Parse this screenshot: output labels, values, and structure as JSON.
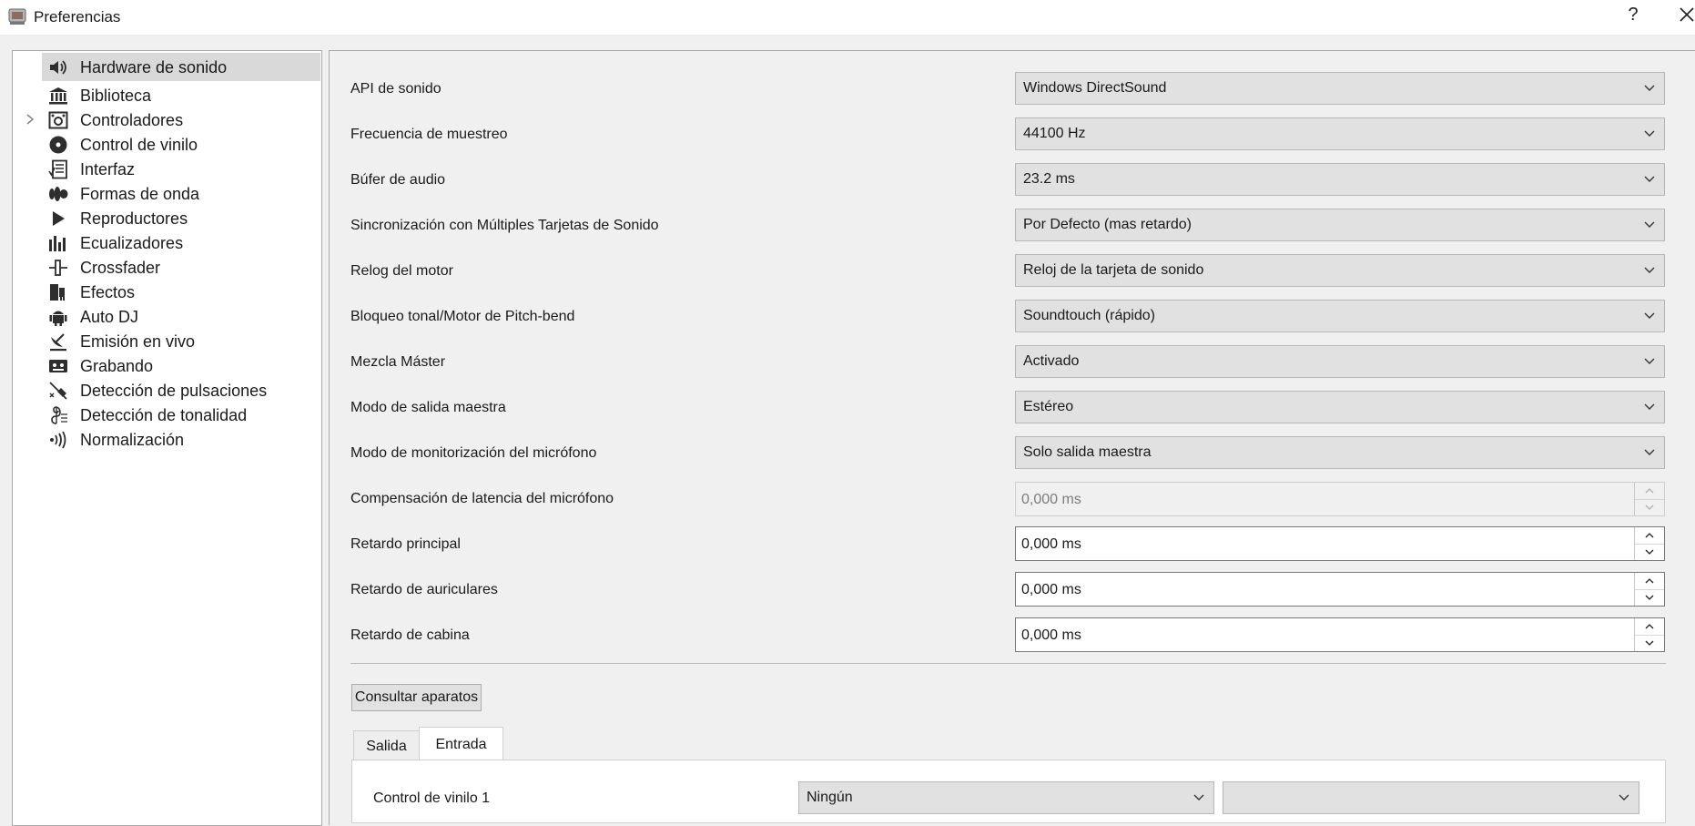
{
  "window": {
    "title": "Preferencias",
    "help": "?"
  },
  "sidebar": {
    "items": [
      {
        "label": "Hardware de sonido",
        "icon": "speaker-icon",
        "selected": true
      },
      {
        "label": "Biblioteca",
        "icon": "library-icon"
      },
      {
        "label": "Controladores",
        "icon": "controller-icon",
        "expandable": true
      },
      {
        "label": "Control de vinilo",
        "icon": "vinyl-icon"
      },
      {
        "label": "Interfaz",
        "icon": "interface-icon"
      },
      {
        "label": "Formas de onda",
        "icon": "waveform-icon"
      },
      {
        "label": "Reproductores",
        "icon": "play-icon"
      },
      {
        "label": "Ecualizadores",
        "icon": "equalizer-icon"
      },
      {
        "label": "Crossfader",
        "icon": "crossfader-icon"
      },
      {
        "label": "Efectos",
        "icon": "effects-icon"
      },
      {
        "label": "Auto DJ",
        "icon": "robot-icon"
      },
      {
        "label": "Emisión en vivo",
        "icon": "broadcast-icon"
      },
      {
        "label": "Grabando",
        "icon": "cassette-icon"
      },
      {
        "label": "Detección de pulsaciones",
        "icon": "metronome-icon"
      },
      {
        "label": "Detección de tonalidad",
        "icon": "music-key-icon"
      },
      {
        "label": "Normalización",
        "icon": "normalize-icon"
      }
    ]
  },
  "settings": [
    {
      "label": "API de sonido",
      "value": "Windows DirectSound",
      "kind": "combo"
    },
    {
      "label": "Frecuencia de muestreo",
      "value": "44100 Hz",
      "kind": "combo"
    },
    {
      "label": "Búfer de audio",
      "value": "23.2 ms",
      "kind": "combo"
    },
    {
      "label": "Sincronización con Múltiples Tarjetas de Sonido",
      "value": "Por Defecto (mas retardo)",
      "kind": "combo"
    },
    {
      "label": "Relog del motor",
      "value": "Reloj de la tarjeta de sonido",
      "kind": "combo"
    },
    {
      "label": "Bloqueo tonal/Motor de Pitch-bend",
      "value": "Soundtouch (rápido)",
      "kind": "combo"
    },
    {
      "label": "Mezcla Máster",
      "value": "Activado",
      "kind": "combo"
    },
    {
      "label": "Modo de salida maestra",
      "value": "Estéreo",
      "kind": "combo"
    },
    {
      "label": "Modo de monitorización del micrófono",
      "value": "Solo salida maestra",
      "kind": "combo"
    },
    {
      "label": "Compensación de latencia del micrófono",
      "value": "0,000 ms",
      "kind": "spin",
      "disabled": true
    },
    {
      "label": "Retardo principal",
      "value": "0,000 ms",
      "kind": "spin"
    },
    {
      "label": "Retardo de auriculares",
      "value": "0,000 ms",
      "kind": "spin"
    },
    {
      "label": "Retardo de cabina",
      "value": "0,000 ms",
      "kind": "spin"
    }
  ],
  "query_button": "Consultar aparatos",
  "tabs": [
    {
      "label": "Salida",
      "active": false
    },
    {
      "label": "Entrada",
      "active": true
    }
  ],
  "input_tab": {
    "row_label": "Control de vinilo 1",
    "device_value": "Ningún",
    "channel_value": ""
  },
  "colors": {
    "selected_bg": "#d9d9d9",
    "panel_bg": "#f0f0f0",
    "combo_bg": "#e1e1e1"
  }
}
